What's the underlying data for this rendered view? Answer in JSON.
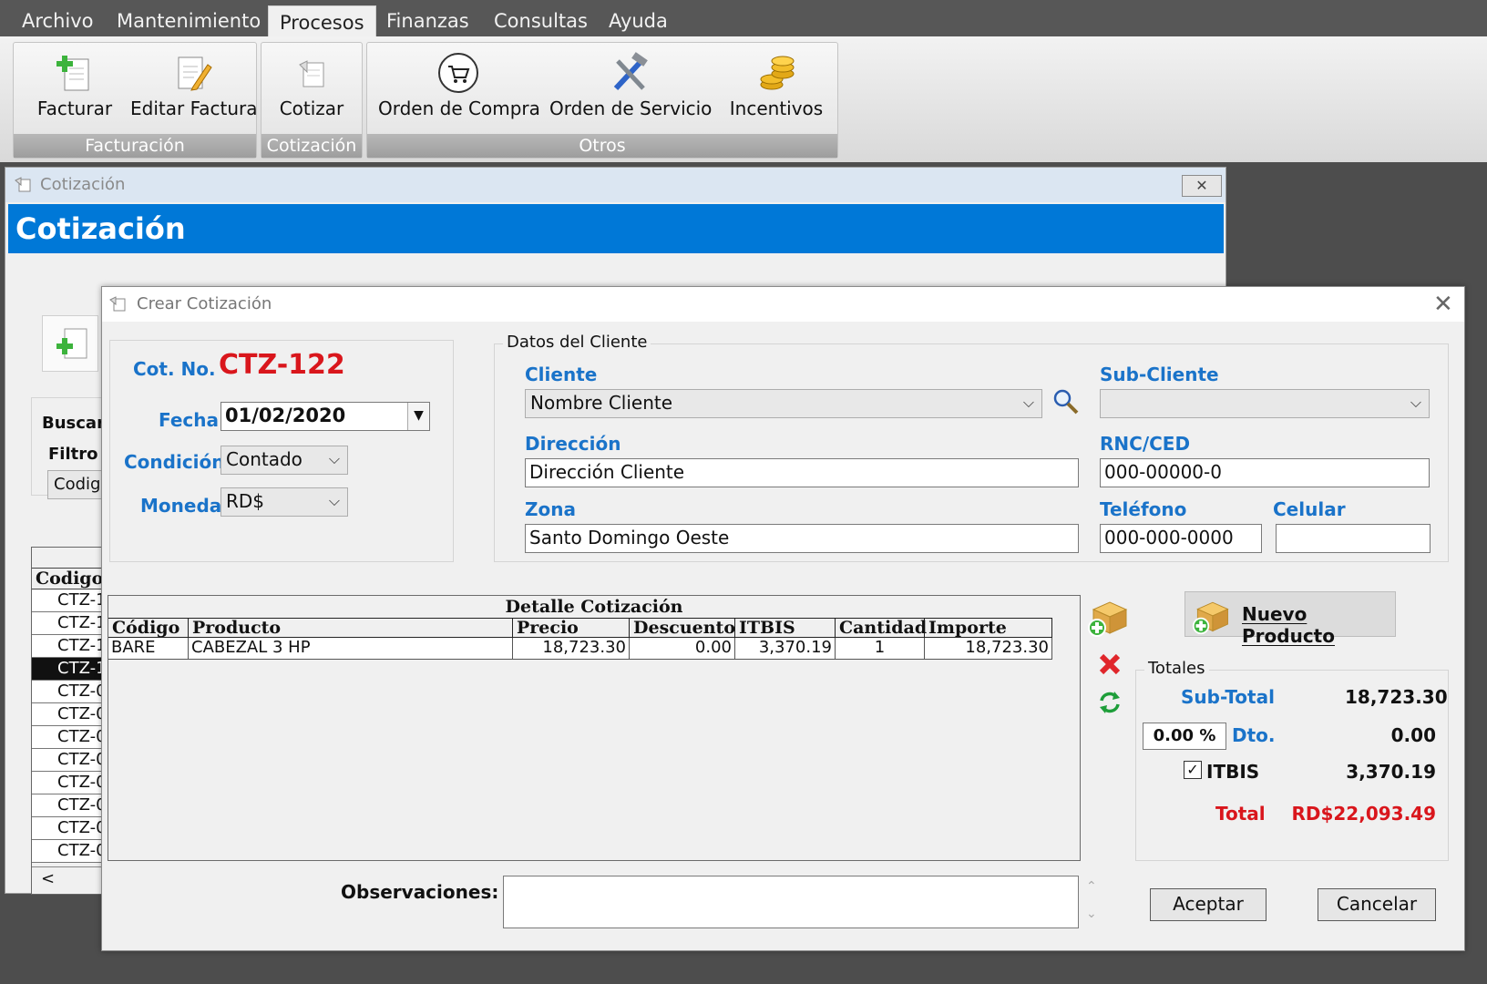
{
  "menu": [
    "Archivo",
    "Mantenimiento",
    "Procesos",
    "Finanzas",
    "Consultas",
    "Ayuda"
  ],
  "ribbon": {
    "facturacion": {
      "label": "Facturación",
      "buttons": [
        "Facturar",
        "Editar Factura"
      ]
    },
    "cotizacion": {
      "label": "Cotización",
      "buttons": [
        "Cotizar"
      ]
    },
    "otros": {
      "label": "Otros",
      "buttons": [
        "Orden de Compra",
        "Orden de Servicio",
        "Incentivos"
      ]
    }
  },
  "back_window": {
    "title": "Cotización",
    "header": "Cotización",
    "buscar": "Buscar",
    "filtro": "Filtro",
    "filtro_value": "Codigo",
    "list_header": "Codigo",
    "rows": [
      "CTZ-1",
      "CTZ-1",
      "CTZ-1",
      "CTZ-1",
      "CTZ-0",
      "CTZ-0",
      "CTZ-0",
      "CTZ-0",
      "CTZ-0",
      "CTZ-0",
      "CTZ-0",
      "CTZ-0"
    ],
    "selected_row": 3,
    "scroll_left": "<"
  },
  "dialog": {
    "title": "Crear Cotización",
    "cot_label": "Cot. No.",
    "cot_number": "CTZ-122",
    "fecha_label": "Fecha",
    "fecha": "01/02/2020",
    "condicion_label": "Condición",
    "condicion": "Contado",
    "moneda_label": "Moneda",
    "moneda": "RD$",
    "client_group": "Datos del Cliente",
    "cliente_label": "Cliente",
    "cliente": "Nombre Cliente",
    "subcliente_label": "Sub-Cliente",
    "subcliente": "",
    "direccion_label": "Dirección",
    "direccion": "Dirección Cliente",
    "rnc_label": "RNC/CED",
    "rnc": "000-00000-0",
    "zona_label": "Zona",
    "zona": "Santo Domingo Oeste",
    "telefono_label": "Teléfono",
    "telefono": "000-000-0000",
    "celular_label": "Celular",
    "celular": ""
  },
  "detail": {
    "title": "Detalle Cotización",
    "columns": [
      "Código",
      "Producto",
      "Precio",
      "Descuento",
      "ITBIS",
      "Cantidad",
      "Importe"
    ],
    "rows": [
      [
        "BARE",
        "CABEZAL 3 HP",
        "18,723.30",
        "0.00",
        "3,370.19",
        "1",
        "18,723.30"
      ]
    ]
  },
  "nuevo_producto": "Nuevo Producto",
  "totales": {
    "label": "Totales",
    "subtotal_label": "Sub-Total",
    "subtotal": "18,723.30",
    "dto_pct": "0.00 %",
    "dto_label": "Dto.",
    "dto": "0.00",
    "itbis_label": "ITBIS",
    "itbis_checked": true,
    "itbis": "3,370.19",
    "total_label": "Total",
    "total": "RD$22,093.49"
  },
  "observaciones_label": "Observaciones:",
  "observaciones": "",
  "buttons": {
    "aceptar": "Aceptar",
    "cancelar": "Cancelar"
  },
  "colors": {
    "accent": "#0078d7",
    "label_blue": "#1a73c9",
    "red": "#d9161c"
  }
}
